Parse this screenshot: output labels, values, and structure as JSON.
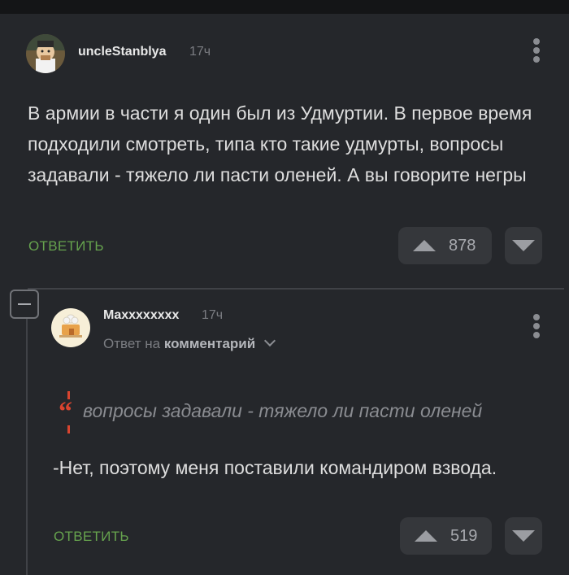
{
  "comments": [
    {
      "username": "uncleStanblya",
      "time": "17ч",
      "text": "В армии в части я один был из Удмуртии. В первое время подходили смотреть, типа кто такие удмурты, вопросы задавали - тяжело ли пасти оленей. А вы говорите негры",
      "reply_label": "ОТВЕТИТЬ",
      "rating": "878"
    },
    {
      "username": "Maxxxxxxxx",
      "time": "17ч",
      "reply_to_prefix": "Ответ на",
      "reply_to_target": "комментарий",
      "quote": "вопросы задавали - тяжело ли пасти оленей",
      "text": "-Нет, поэтому меня поставили командиром взвода.",
      "reply_label": "ОТВЕТИТЬ",
      "rating": "519"
    }
  ],
  "colors": {
    "background": "#25272b",
    "accent_green": "#66a34e",
    "quote_red": "#d9442f",
    "vote_button": "#35373b"
  },
  "icons": {
    "more": "more-vertical-icon",
    "upvote": "arrow-up-icon",
    "downvote": "arrow-down-icon",
    "collapse": "minus-icon",
    "chevron": "chevron-down-icon",
    "quote": "quote-icon"
  }
}
